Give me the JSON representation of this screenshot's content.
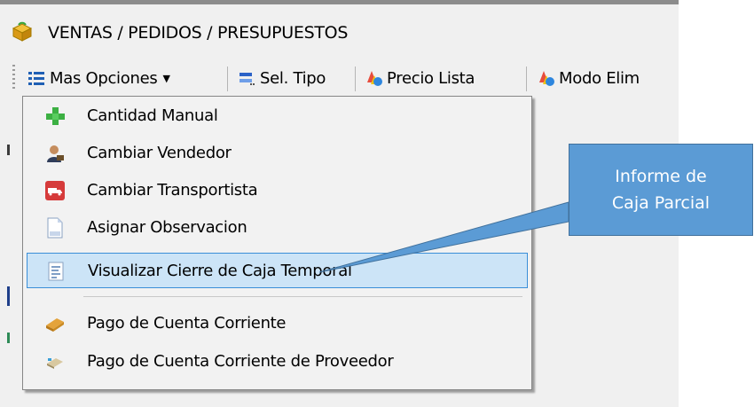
{
  "window": {
    "title": "VENTAS / PEDIDOS / PRESUPUESTOS",
    "title_icon": "package-icon"
  },
  "toolbar": {
    "items": [
      {
        "label": "Mas Opciones",
        "icon": "list-icon",
        "has_dropdown": true
      },
      {
        "label": "Sel. Tipo",
        "icon": "select-type-icon"
      },
      {
        "label": "Precio Lista",
        "icon": "price-list-icon"
      },
      {
        "label": "Modo Elim",
        "icon": "delete-mode-icon"
      }
    ]
  },
  "menu": {
    "items": [
      {
        "label": "Cantidad Manual",
        "icon": "green-plus-icon"
      },
      {
        "label": "Cambiar Vendedor",
        "icon": "salesperson-icon"
      },
      {
        "label": "Cambiar Transportista",
        "icon": "truck-icon"
      },
      {
        "label": "Asignar Observacion",
        "icon": "document-icon"
      },
      {
        "label": "Visualizar Cierre de Caja Temporal",
        "icon": "report-icon",
        "highlighted": true
      },
      {
        "label": "Pago de Cuenta Corriente",
        "icon": "payment-icon"
      },
      {
        "label": "Pago de Cuenta Corriente de Proveedor",
        "icon": "supplier-payment-icon"
      }
    ]
  },
  "callout": {
    "line1": "Informe de",
    "line2": "Caja Parcial",
    "fill": "#5b9bd5",
    "border": "#41719c"
  },
  "colors": {
    "highlight_bg": "#cce4f7",
    "highlight_border": "#3a8ed8",
    "window_bg": "#f0f0f0"
  }
}
